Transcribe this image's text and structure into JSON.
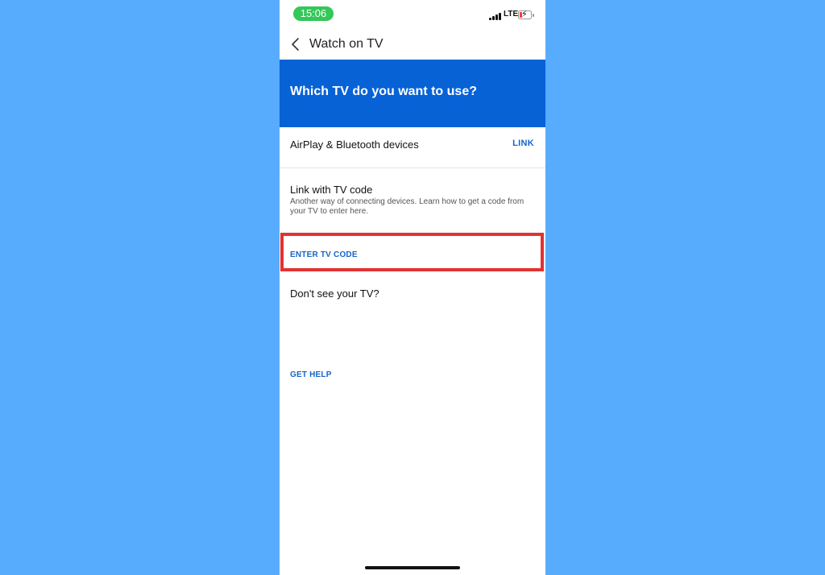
{
  "status_bar": {
    "time": "15:06",
    "network": "LTE",
    "icons": [
      "signal-icon",
      "battery-charging-icon"
    ],
    "battery_color": "#ff3b30",
    "time_pill_color": "#34c759"
  },
  "header": {
    "back_icon": "chevron-left-icon",
    "title": "Watch on TV"
  },
  "banner": {
    "title": "Which TV do you want to use?",
    "color": "#0762d6"
  },
  "airplay_row": {
    "label": "AirPlay & Bluetooth devices",
    "action": "LINK"
  },
  "tv_code": {
    "title": "Link with TV code",
    "description": "Another way of connecting devices. Learn how to get a code from your TV to enter here.",
    "action": "ENTER TV CODE",
    "highlight_color": "#e23232"
  },
  "help": {
    "question": "Don't see your TV?",
    "action": "GET HELP"
  },
  "theme": {
    "background": "#58acfd",
    "accent": "#1665c8"
  }
}
